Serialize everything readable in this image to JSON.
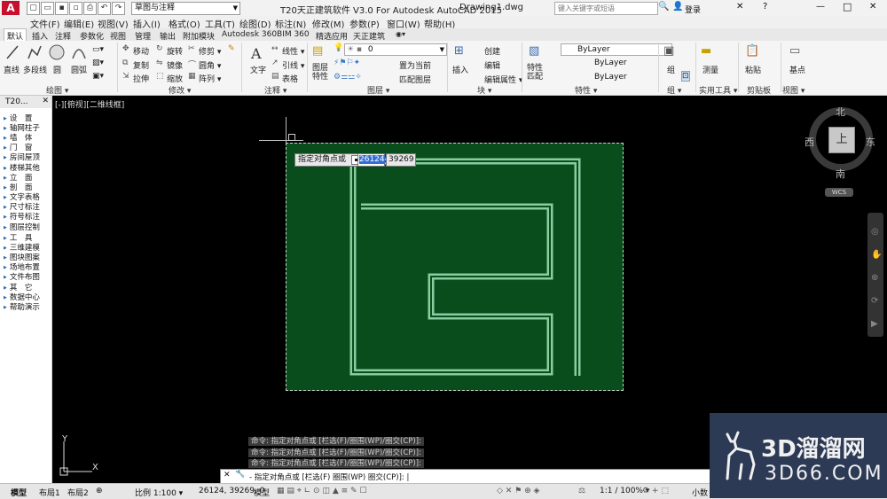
{
  "title_bar": {
    "title": "T20天正建筑软件 V3.0 For Autodesk AutoCAD 2015",
    "file": "Drawing1.dwg",
    "workspace": "草图与注释",
    "search_placeholder": "键入关键字或短语",
    "login": "登录",
    "minimize": "—",
    "restore": "□",
    "close": "✕"
  },
  "menu": [
    "文件(F)",
    "编辑(E)",
    "视图(V)",
    "插入(I)",
    "格式(O)",
    "工具(T)",
    "绘图(D)",
    "标注(N)",
    "修改(M)",
    "参数(P)",
    "窗口(W)",
    "帮助(H)"
  ],
  "tabs": [
    "默认",
    "插入",
    "注释",
    "参数化",
    "视图",
    "管理",
    "输出",
    "附加模块",
    "Autodesk 360",
    "BIM 360",
    "精选应用",
    "天正建筑"
  ],
  "ribbon": {
    "draw": {
      "label": "绘图 ▾",
      "line": "直线",
      "polyline": "多段线",
      "circle": "圆",
      "arc": "圆弧"
    },
    "modify": {
      "label": "修改 ▾",
      "move": "移动",
      "rotate": "旋转",
      "trim": "修剪 ▾",
      "copy": "复制",
      "mirror": "镜像",
      "fillet": "圆角 ▾",
      "stretch": "拉伸",
      "scale": "缩放",
      "array": "阵列 ▾"
    },
    "annotation": {
      "label": "注释 ▾",
      "text": "文字",
      "dim": "线性 ▾",
      "leader": "引线 ▾",
      "table": "表格"
    },
    "layers": {
      "label": "图层 ▾",
      "props": "图层特性",
      "current_layer": "0",
      "set_current": "置为当前",
      "match": "匹配图层"
    },
    "block": {
      "label": "块 ▾",
      "insert": "插入",
      "create": "创建",
      "edit": "编辑",
      "edit_attr": "编辑属性 ▾"
    },
    "properties": {
      "label": "特性 ▾",
      "match": "特性匹配",
      "bylayer1": "ByLayer",
      "bylayer2": "ByLayer",
      "bylayer3": "ByLayer"
    },
    "group": {
      "label": "组 ▾",
      "group": "组"
    },
    "utilities": {
      "label": "实用工具 ▾",
      "measure": "测量"
    },
    "clipboard": {
      "label": "剪贴板",
      "paste": "粘贴"
    },
    "view": {
      "label": "视图 ▾",
      "base": "基点"
    }
  },
  "palette": {
    "title": "T20...",
    "items": [
      "设　置",
      "轴网柱子",
      "墙　体",
      "门　窗",
      "房间屋顶",
      "楼梯其他",
      "立　面",
      "剖　面",
      "文字表格",
      "尺寸标注",
      "符号标注",
      "图层控制",
      "工　具",
      "三维建模",
      "图块图案",
      "场地布置",
      "文件布图",
      "其　它",
      "数据中心",
      "帮助演示"
    ]
  },
  "viewport": {
    "label": "[-][俯视][二维线框]",
    "prompt": "指定对角点或",
    "input_x": "26124",
    "input_y": "39269",
    "compass": {
      "north": "北",
      "south": "南",
      "east": "东",
      "west": "西",
      "top": "上",
      "wcs": "WCS"
    },
    "axis_x": "X",
    "axis_y": "Y"
  },
  "command": {
    "history": [
      "命令: 指定对角点或 [栏选(F)/圈围(WP)/圈交(CP)]:",
      "命令: 指定对角点或 [栏选(F)/圈围(WP)/圈交(CP)]:",
      "命令: 指定对角点或 [栏选(F)/圈围(WP)/圈交(CP)]:"
    ],
    "line": "- 指定对角点或 [栏选(F) 圈围(WP) 圈交(CP)]: |"
  },
  "status": {
    "tab_model": "模型",
    "tab_layout1": "布局1",
    "tab_layout2": "布局2",
    "scale": "比例 1:100 ▾",
    "coords": "26124, 39269, 0",
    "model": "模型",
    "zoom": "1:1 / 100% ▾",
    "decimal": "小数"
  },
  "watermark": {
    "brand": "3D溜溜网",
    "url": "3D66.COM"
  },
  "colors": {
    "selection_fill": "#0a4d1c",
    "wall": "#8fd3a8",
    "background": "#000000",
    "accent_red": "#c8102e"
  }
}
